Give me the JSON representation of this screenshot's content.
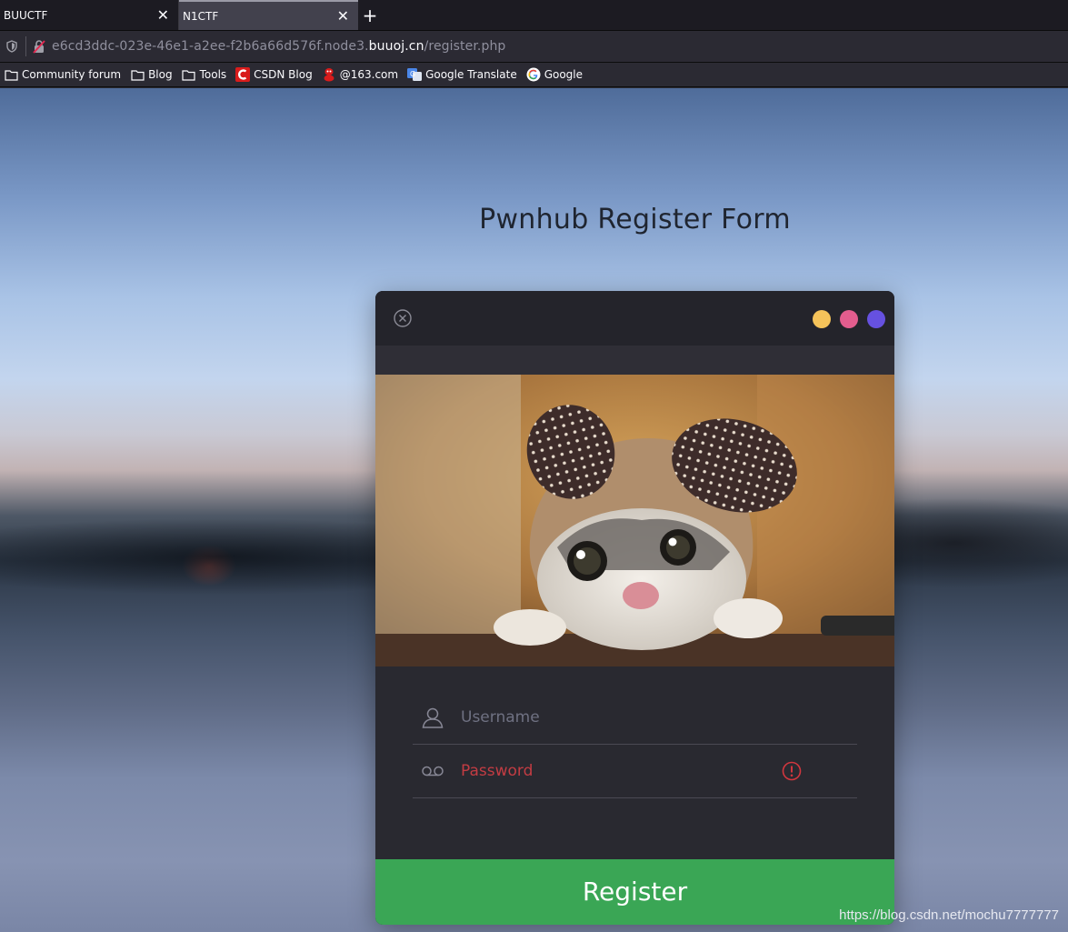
{
  "browser": {
    "tabs": [
      {
        "label": "BUUCTF",
        "active": false
      },
      {
        "label": "N1CTF",
        "active": true
      }
    ],
    "new_tab_label": "+",
    "url": {
      "prefix": "e6cd3ddc-023e-46e1-a2ee-f2b6a66d576f.node3.",
      "host": "buuoj.cn",
      "path": "/register.php"
    },
    "bookmarks": [
      {
        "label": "Community forum",
        "icon": "folder-icon"
      },
      {
        "label": "Blog",
        "icon": "folder-icon"
      },
      {
        "label": "Tools",
        "icon": "folder-icon"
      },
      {
        "label": "CSDN Blog",
        "icon": "csdn-icon"
      },
      {
        "label": "@163.com",
        "icon": "163-icon"
      },
      {
        "label": "Google Translate",
        "icon": "google-translate-icon"
      },
      {
        "label": "Google",
        "icon": "google-icon"
      }
    ]
  },
  "page": {
    "title": "Pwnhub Register Form",
    "window_dots": [
      "#f5c35a",
      "#e35d8e",
      "#6651e0"
    ],
    "form": {
      "username_placeholder": "Username",
      "password_placeholder": "Password",
      "password_error": true
    },
    "register_label": "Register",
    "accent_color": "#3aa655",
    "watermark": "https://blog.csdn.net/mochu7777777"
  }
}
